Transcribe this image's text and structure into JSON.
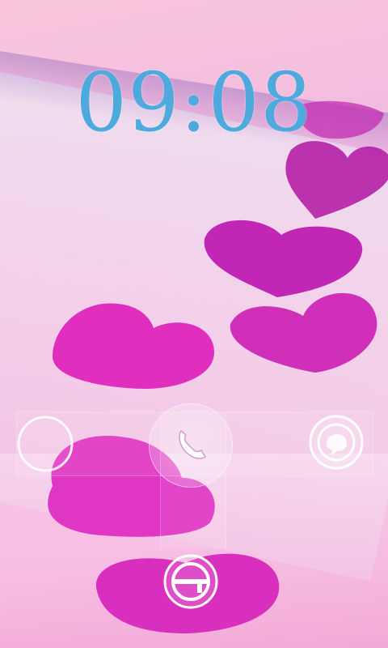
{
  "lockscreen": {
    "time": "09:08"
  },
  "targets": {
    "left": {
      "icon": "empty-ring-icon"
    },
    "center": {
      "icon": "phone-handset-icon"
    },
    "right": {
      "icon": "chat-bubble-icon"
    },
    "bottom": {
      "icon": "unlock-g-icon"
    }
  },
  "colors": {
    "clock": "#4ea9dd",
    "heart": "#e23fb5",
    "background": "#f5bfe0"
  }
}
